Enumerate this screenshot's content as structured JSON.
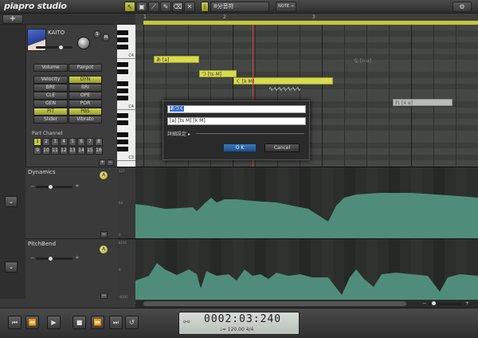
{
  "app": {
    "logo": "piapro studio"
  },
  "toolbar": {
    "tools": [
      "arrow-tool",
      "pencil-select-tool",
      "line-tool",
      "pencil-tool",
      "eraser-tool",
      "close-x-tool"
    ],
    "snap_label": "8分音符",
    "grid_label": "♪♪",
    "note_label": "NOTE →",
    "gear": "⚙"
  },
  "track": {
    "name": "KAITO",
    "solo": "S",
    "mute": "M",
    "add": "+"
  },
  "ruler": {
    "marks": [
      "1",
      "2",
      "3"
    ]
  },
  "panel": {
    "volume": "Volume",
    "panpot": "Panpot",
    "buttons": [
      [
        "Velocity",
        "DYN"
      ],
      [
        "BRE",
        "BRI"
      ],
      [
        "CLE",
        "OPE"
      ],
      [
        "GEN",
        "POR"
      ],
      [
        "PIT",
        "PBS"
      ],
      [
        "Slider",
        "Vibrato"
      ]
    ],
    "part_channel_label": "Part Channel",
    "channels": [
      "1",
      "2",
      "3",
      "4",
      "5",
      "6",
      "7",
      "8",
      "9",
      "10",
      "11",
      "12",
      "13",
      "14",
      "15",
      "16"
    ]
  },
  "piano": {
    "labels": [
      "C4",
      "C4",
      "C3"
    ]
  },
  "notes": [
    {
      "text": "あ [a]"
    },
    {
      "text": "つ [ts M]"
    },
    {
      "text": "く [k M]"
    },
    {
      "text": "な [n a]"
    },
    {
      "text": "れ [4 e]"
    }
  ],
  "dialog": {
    "lyric_value": "あつく",
    "phoneme_value": "[a] [ts M] [k M]",
    "advanced_label": "詳細設定",
    "ok_label": "O K",
    "cancel_label": "Cancel"
  },
  "params": [
    {
      "name": "Dynamics",
      "scale": [
        "127",
        "64",
        "0"
      ]
    },
    {
      "name": "PitchBend",
      "scale": [
        "8191",
        "0",
        "-8192"
      ]
    }
  ],
  "transport": {
    "time": "0002:03:240",
    "tempo": "♩= 120.00   4/4",
    "buttons": [
      "⏮",
      "⏪",
      "▶",
      "■",
      "⏩",
      "⏭",
      "↺"
    ]
  }
}
